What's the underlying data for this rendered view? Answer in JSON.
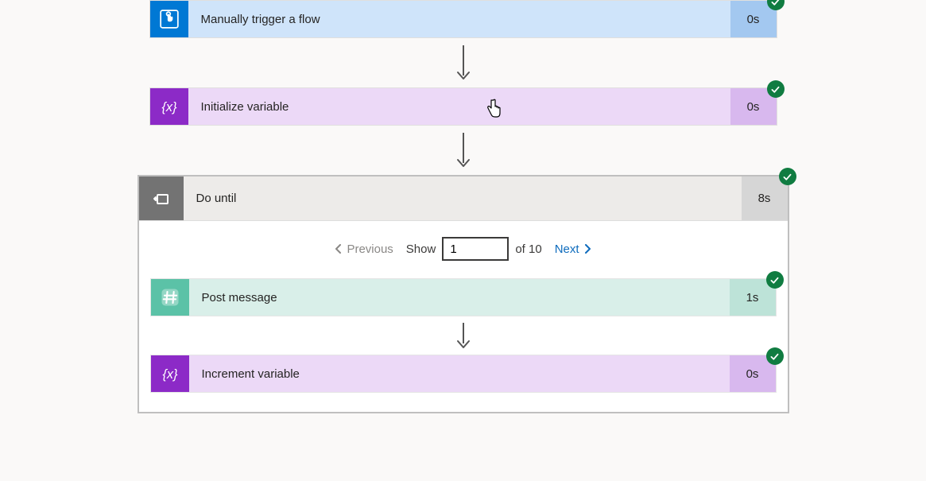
{
  "steps": {
    "trigger": {
      "label": "Manually trigger a flow",
      "duration": "0s"
    },
    "init_var": {
      "label": "Initialize variable",
      "duration": "0s"
    },
    "do_until": {
      "label": "Do until",
      "duration": "8s",
      "pager": {
        "prev_label": "Previous",
        "show_label": "Show",
        "value": "1",
        "total_label": "of 10",
        "next_label": "Next"
      },
      "children": {
        "post_message": {
          "label": "Post message",
          "duration": "1s"
        },
        "increment_var": {
          "label": "Increment variable",
          "duration": "0s"
        }
      }
    }
  }
}
